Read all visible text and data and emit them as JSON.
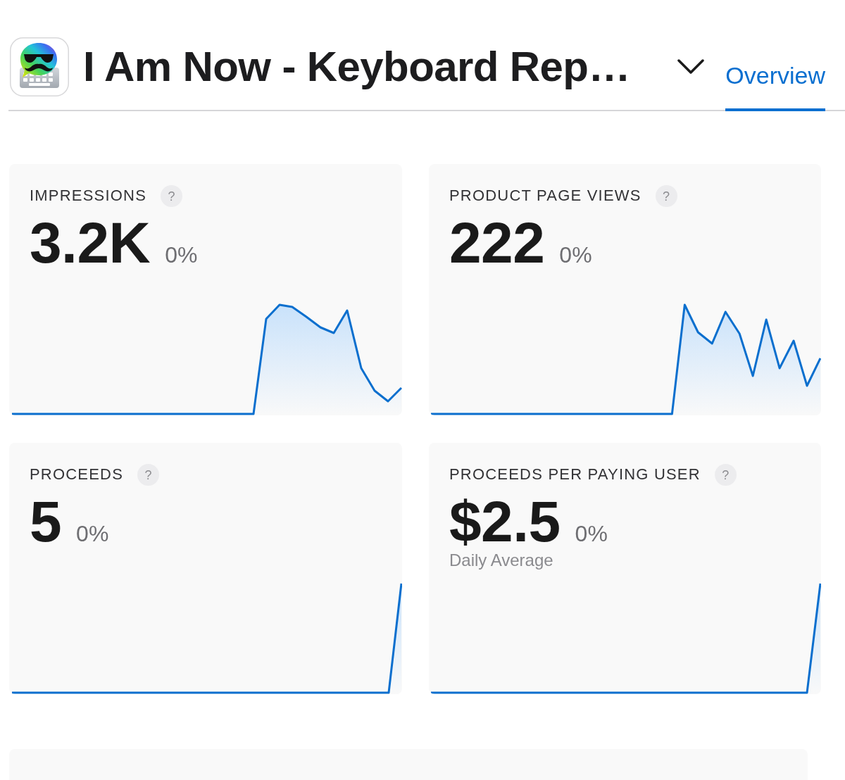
{
  "header": {
    "app_title": "I Am Now - Keyboard Rep…",
    "tabs": [
      {
        "label": "Overview",
        "selected": true
      }
    ]
  },
  "metrics": [
    {
      "label": "IMPRESSIONS",
      "help": "?",
      "value": "3.2K",
      "change": "0%"
    },
    {
      "label": "PRODUCT PAGE VIEWS",
      "help": "?",
      "value": "222",
      "change": "0%"
    },
    {
      "label": "PROCEEDS",
      "help": "?",
      "value": "5",
      "change": "0%"
    },
    {
      "label": "PROCEEDS PER PAYING USER",
      "help": "?",
      "value": "$2.5",
      "change": "0%",
      "note": "Daily Average"
    }
  ]
}
